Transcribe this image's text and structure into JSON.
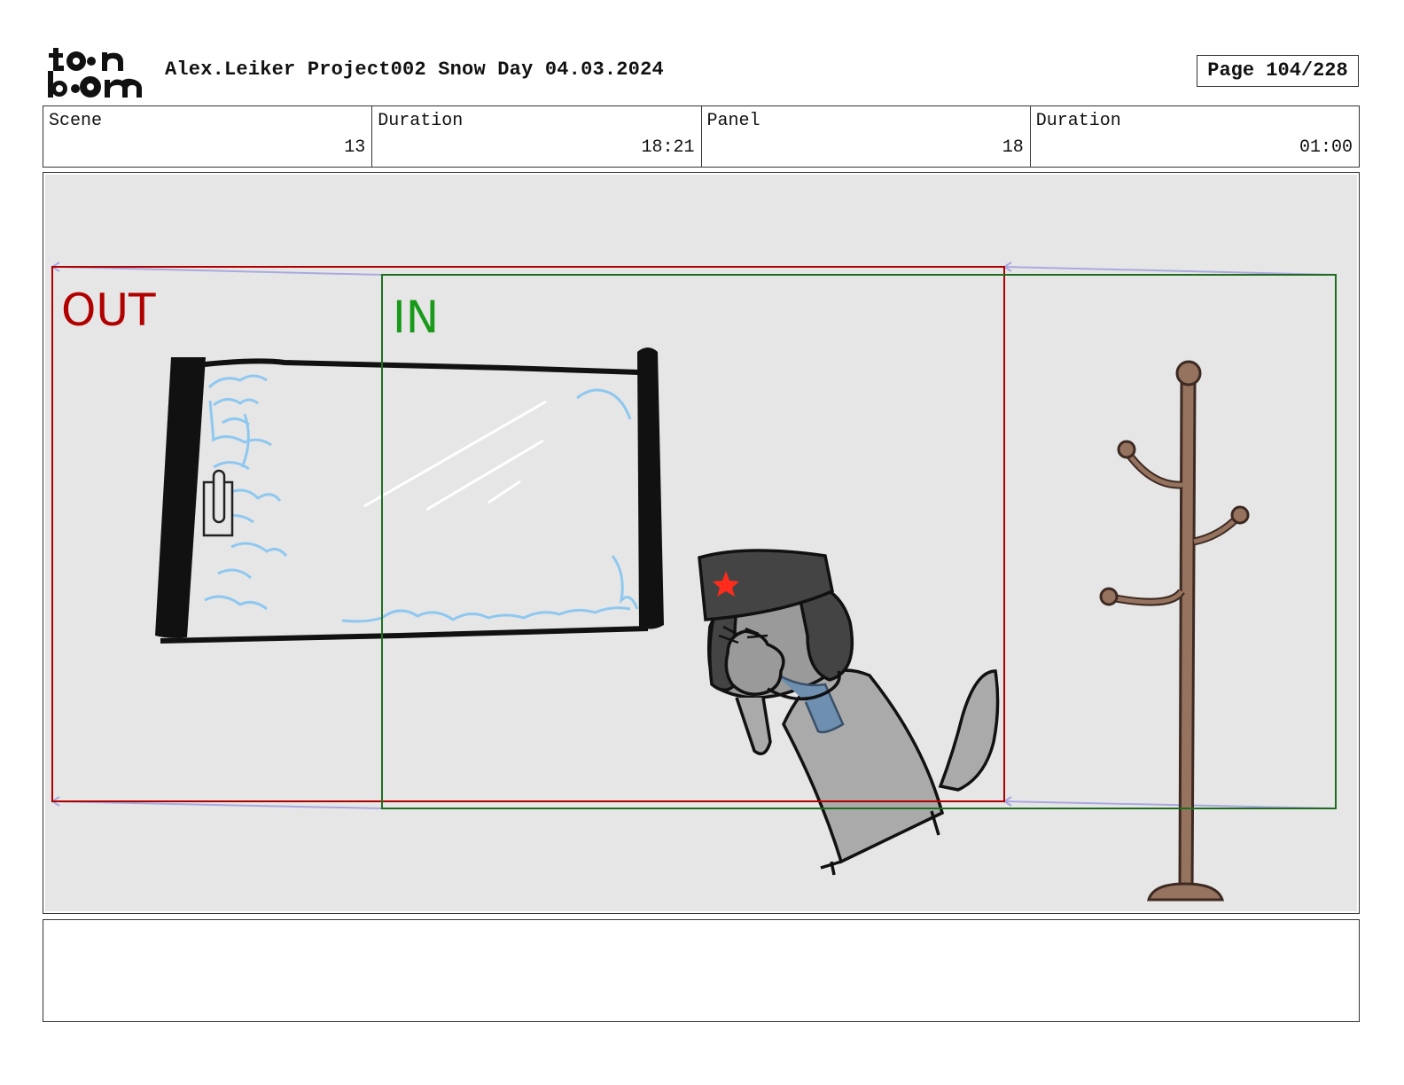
{
  "header": {
    "logo": {
      "line1": "toon",
      "line2": "boom"
    },
    "title": "Alex.Leiker Project002 Snow Day 04.03.2024",
    "page": "Page 104/228"
  },
  "info": {
    "scene_label": "Scene",
    "scene_value": "13",
    "scene_duration_label": "Duration",
    "scene_duration_value": "18:21",
    "panel_label": "Panel",
    "panel_value": "18",
    "panel_duration_label": "Duration",
    "panel_duration_value": "01:00"
  },
  "panel": {
    "background_color": "#e6e6e6",
    "out_label": "OUT",
    "out_color": "#b00000",
    "in_label": "IN",
    "in_color": "#1a9a1a",
    "in_frame_color": "#1f6e1f",
    "motion_line_color": "#a9a9e0",
    "frost_color": "#8ec8f0",
    "coat_rack_color": "#96735f",
    "hat_star_color": "#ff2b1c"
  },
  "notes": {
    "text": ""
  }
}
